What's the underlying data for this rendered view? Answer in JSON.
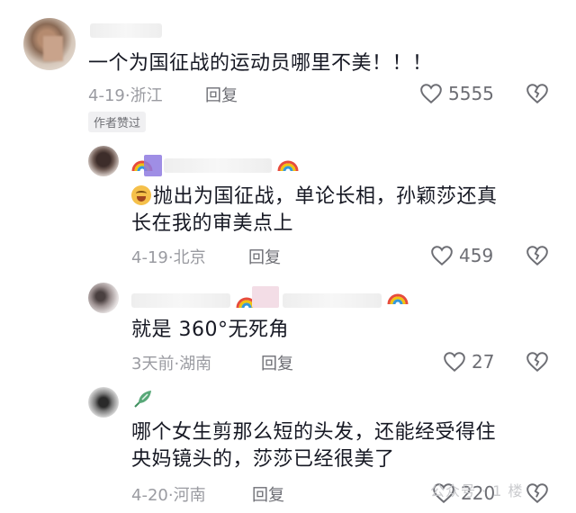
{
  "comments": [
    {
      "text": "一个为国征战的运动员哪里不美！！！",
      "date": "4-19",
      "location": "浙江",
      "reply_label": "回复",
      "likes": "5555",
      "badge": "作者赞过"
    },
    {
      "text": "抛出为国征战，单论长相，孙颖莎还真长在我的审美点上",
      "line1": "抛出为国征战，单论长相，孙颖莎还真",
      "line2": "长在我的审美点上",
      "date": "4-19",
      "location": "北京",
      "reply_label": "回复",
      "likes": "459"
    },
    {
      "text": "就是 360°无死角",
      "date": "3天前",
      "location": "湖南",
      "reply_label": "回复",
      "likes": "27"
    },
    {
      "text": "哪个女生剪那么短的头发，还能经受得住央妈镜头的，莎莎已经很美了",
      "line1": "哪个女生剪那么短的头发，还能经受得住",
      "line2": "央妈镜头的，莎莎已经很美了",
      "date": "4-20",
      "location": "河南",
      "reply_label": "回复",
      "likes": "220"
    }
  ],
  "separator": "·",
  "watermark": "公众号 · 1 楼",
  "icons": {
    "like": "heart-outline-icon",
    "dislike": "broken-heart-icon",
    "badge_emoji": "rainbow-emoji",
    "comment_emoji": "laughing-tears-emoji"
  },
  "colors": {
    "text": "#161823",
    "meta": "#9a9ba1",
    "icon": "#6d6e74"
  }
}
